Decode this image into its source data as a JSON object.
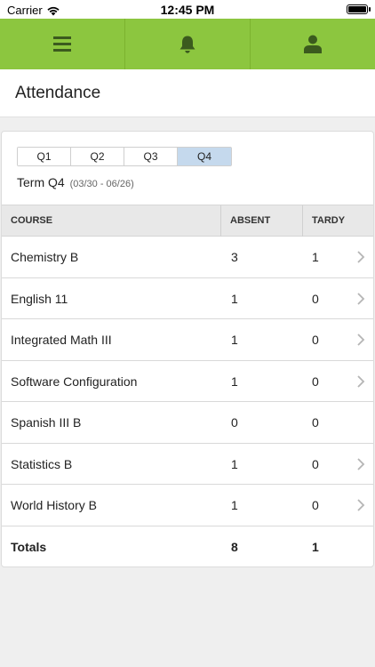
{
  "status_bar": {
    "carrier": "Carrier",
    "time": "12:45 PM"
  },
  "nav": {
    "items": [
      "menu-icon",
      "bell-icon",
      "user-icon"
    ]
  },
  "page": {
    "title": "Attendance"
  },
  "terms": {
    "tabs": [
      "Q1",
      "Q2",
      "Q3",
      "Q4"
    ],
    "selected": "Q4",
    "term_label": "Term Q4",
    "term_range": "(03/30 - 06/26)"
  },
  "table": {
    "headers": {
      "course": "COURSE",
      "absent": "ABSENT",
      "tardy": "TARDY"
    },
    "rows": [
      {
        "course": "Chemistry B",
        "absent": "3",
        "tardy": "1",
        "has_detail": true
      },
      {
        "course": "English 11",
        "absent": "1",
        "tardy": "0",
        "has_detail": true
      },
      {
        "course": "Integrated Math III",
        "absent": "1",
        "tardy": "0",
        "has_detail": true
      },
      {
        "course": "Software Configuration",
        "absent": "1",
        "tardy": "0",
        "has_detail": true
      },
      {
        "course": "Spanish III B",
        "absent": "0",
        "tardy": "0",
        "has_detail": false
      },
      {
        "course": "Statistics B",
        "absent": "1",
        "tardy": "0",
        "has_detail": true
      },
      {
        "course": "World History B",
        "absent": "1",
        "tardy": "0",
        "has_detail": true
      }
    ],
    "totals": {
      "label": "Totals",
      "absent": "8",
      "tardy": "1"
    }
  },
  "colors": {
    "nav_green": "#8cc63f",
    "nav_icon": "#3b5a1e",
    "segment_active": "#c5d9ed"
  }
}
